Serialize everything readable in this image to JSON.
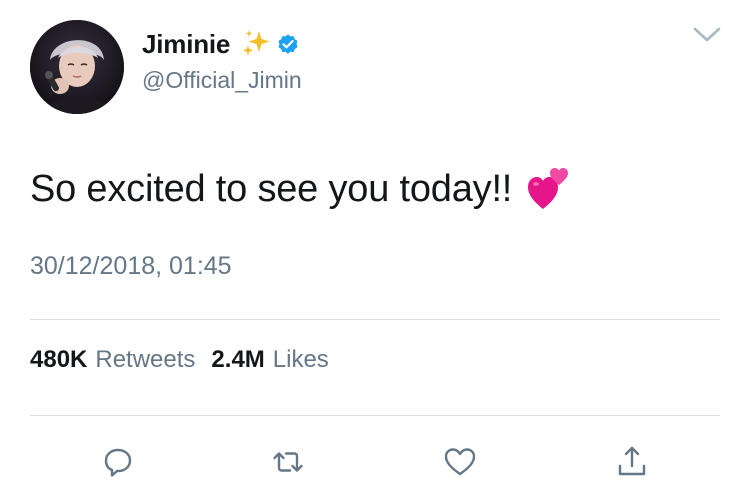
{
  "tweet": {
    "display_name": "Jiminie",
    "handle": "@Official_Jimin",
    "text": "So excited to see you today!!",
    "timestamp": "30/12/2018, 01:45",
    "retweet_count": "480K",
    "retweet_label": "Retweets",
    "like_count": "2.4M",
    "like_label": "Likes"
  },
  "icons": {
    "name_emoji": "sparkles-icon",
    "verified": "verified-badge-icon",
    "text_emoji": "two-hearts-icon",
    "menu": "chevron-down-icon",
    "actions": [
      "reply-icon",
      "retweet-icon",
      "like-icon",
      "share-icon"
    ]
  },
  "colors": {
    "verified_blue": "#1da1f2",
    "secondary_text": "#657786",
    "primary_text": "#14171a",
    "heart_pink": "#e91e8c"
  }
}
